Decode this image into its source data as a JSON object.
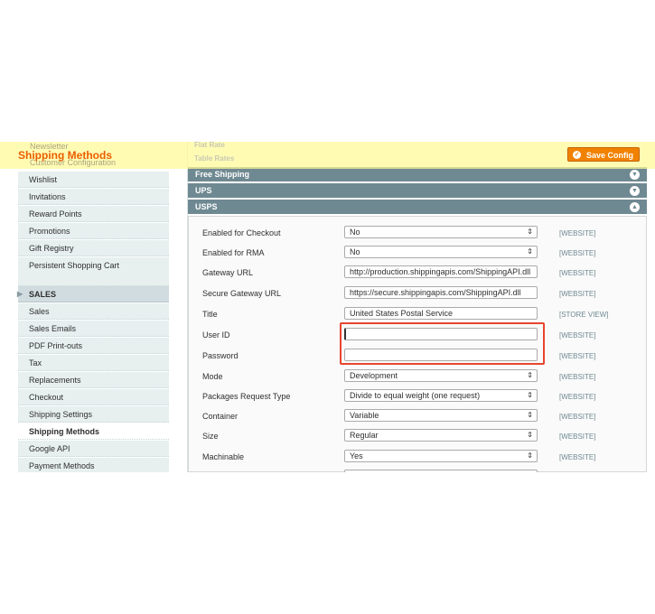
{
  "header": {
    "title": "Shipping Methods",
    "ghost_items": [
      "Newsletter",
      "Customer Configuration"
    ],
    "save_label": "Save Config",
    "ghost_sections": [
      "Flat Rate",
      "Table Rates"
    ]
  },
  "sidebar": {
    "customers_items": [
      "Wishlist",
      "Invitations",
      "Reward Points",
      "Promotions",
      "Gift Registry",
      "Persistent Shopping Cart"
    ],
    "sales_header": "SALES",
    "sales_items": [
      "Sales",
      "Sales Emails",
      "PDF Print-outs",
      "Tax",
      "Replacements",
      "Checkout",
      "Shipping Settings",
      "Shipping Methods",
      "Google API",
      "Payment Methods"
    ],
    "active": "Shipping Methods"
  },
  "sections": [
    {
      "label": "Free Shipping",
      "state": "collapsed"
    },
    {
      "label": "UPS",
      "state": "collapsed"
    },
    {
      "label": "USPS",
      "state": "expanded"
    }
  ],
  "usps_fields": [
    {
      "label": "Enabled for Checkout",
      "type": "select",
      "value": "No",
      "scope": "[WEBSITE]"
    },
    {
      "label": "Enabled for RMA",
      "type": "select",
      "value": "No",
      "scope": "[WEBSITE]"
    },
    {
      "label": "Gateway URL",
      "type": "text",
      "value": "http://production.shippingapis.com/ShippingAPI.dll",
      "scope": "[WEBSITE]"
    },
    {
      "label": "Secure Gateway URL",
      "type": "text",
      "value": "https://secure.shippingapis.com/ShippingAPI.dll",
      "scope": "[WEBSITE]"
    },
    {
      "label": "Title",
      "type": "text",
      "value": "United States Postal Service",
      "scope": "[STORE VIEW]"
    },
    {
      "label": "User ID",
      "type": "text",
      "value": "",
      "scope": "[WEBSITE]"
    },
    {
      "label": "Password",
      "type": "text",
      "value": "",
      "scope": "[WEBSITE]"
    },
    {
      "label": "Mode",
      "type": "select",
      "value": "Development",
      "scope": "[WEBSITE]"
    },
    {
      "label": "Packages Request Type",
      "type": "select",
      "value": "Divide to equal weight (one request)",
      "scope": "[WEBSITE]"
    },
    {
      "label": "Container",
      "type": "select",
      "value": "Variable",
      "scope": "[WEBSITE]"
    },
    {
      "label": "Size",
      "type": "select",
      "value": "Regular",
      "scope": "[WEBSITE]"
    },
    {
      "label": "Machinable",
      "type": "select",
      "value": "Yes",
      "scope": "[WEBSITE]"
    }
  ],
  "colors": {
    "accent": "#eb5e00",
    "section_bar": "#6f8992",
    "highlight": "#e8452f"
  }
}
